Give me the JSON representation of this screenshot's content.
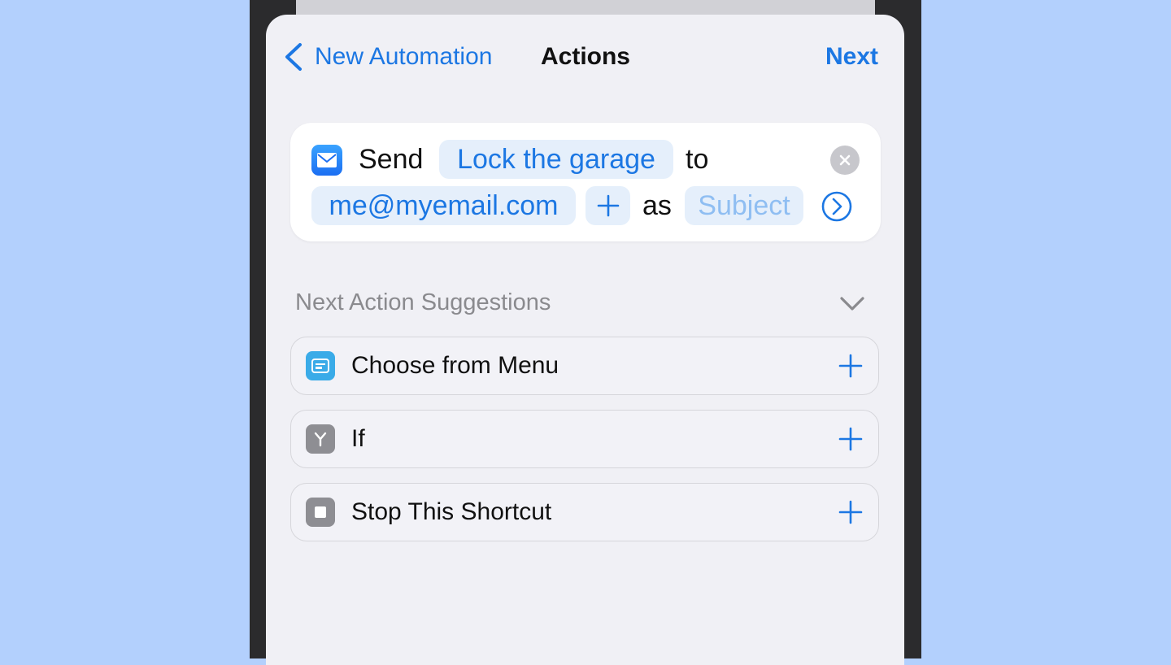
{
  "nav": {
    "back_label": "New Automation",
    "title": "Actions",
    "next_label": "Next"
  },
  "action": {
    "verb": "Send",
    "message_token": "Lock the garage",
    "to_word": "to",
    "recipient_token": "me@myemail.com",
    "add_symbol": "+",
    "as_word": "as",
    "subject_placeholder": "Subject"
  },
  "suggestions": {
    "header": "Next Action Suggestions",
    "items": [
      {
        "label": "Choose from Menu",
        "icon": "menu-icon",
        "icon_color": "#3aabe8"
      },
      {
        "label": "If",
        "icon": "branch-icon",
        "icon_color": "#8e8e93"
      },
      {
        "label": "Stop This Shortcut",
        "icon": "stop-icon",
        "icon_color": "#8e8e93"
      }
    ]
  },
  "colors": {
    "accent": "#1c77e3",
    "background": "#b3d0fd",
    "sheet": "#f0f0f5"
  }
}
